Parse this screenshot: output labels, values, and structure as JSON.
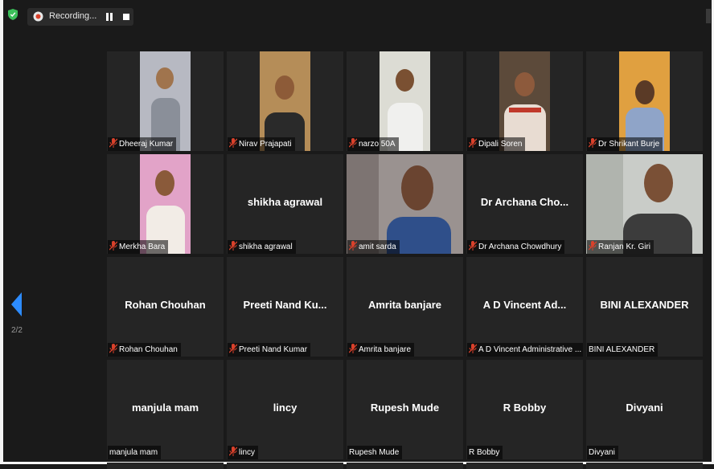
{
  "toolbar": {
    "recording_label": "Recording...",
    "page_indicator": "2/2"
  },
  "colors": {
    "accent": "#2d8cff",
    "mute": "#d9412b",
    "secure": "#3cc05a",
    "tile_bg": "#252525"
  },
  "participants": [
    {
      "label": "Dheeraj Kumar",
      "display": "",
      "muted": true,
      "video": true
    },
    {
      "label": "Nirav Prajapati",
      "display": "",
      "muted": true,
      "video": true
    },
    {
      "label": "narzo 50A",
      "display": "",
      "muted": true,
      "video": true
    },
    {
      "label": "Dipali Soren",
      "display": "",
      "muted": true,
      "video": true
    },
    {
      "label": "Dr Shrikant Burje",
      "display": "",
      "muted": true,
      "video": true
    },
    {
      "label": "Merkha Bara",
      "display": "",
      "muted": true,
      "video": true
    },
    {
      "label": "shikha agrawal",
      "display": "shikha agrawal",
      "muted": true,
      "video": false
    },
    {
      "label": "amit sarda",
      "display": "",
      "muted": true,
      "video": true
    },
    {
      "label": "Dr Archana Chowdhury",
      "display": "Dr Archana Cho...",
      "muted": true,
      "video": false
    },
    {
      "label": "Ranjan Kr. Giri",
      "display": "",
      "muted": true,
      "video": true
    },
    {
      "label": "Rohan Chouhan",
      "display": "Rohan Chouhan",
      "muted": true,
      "video": false
    },
    {
      "label": "Preeti Nand Kumar",
      "display": "Preeti Nand Ku...",
      "muted": true,
      "video": false
    },
    {
      "label": "Amrita banjare",
      "display": "Amrita banjare",
      "muted": true,
      "video": false
    },
    {
      "label": "A D Vincent Administrative ...",
      "display": "A D Vincent Ad...",
      "muted": true,
      "video": false
    },
    {
      "label": "BINI ALEXANDER",
      "display": "BINI ALEXANDER",
      "muted": false,
      "video": false
    },
    {
      "label": "manjula mam",
      "display": "manjula mam",
      "muted": false,
      "video": false
    },
    {
      "label": "lincy",
      "display": "lincy",
      "muted": true,
      "video": false
    },
    {
      "label": "Rupesh Mude",
      "display": "Rupesh Mude",
      "muted": false,
      "video": false
    },
    {
      "label": "R Bobby",
      "display": "R Bobby",
      "muted": false,
      "video": false
    },
    {
      "label": "Divyani",
      "display": "Divyani",
      "muted": false,
      "video": false
    }
  ]
}
